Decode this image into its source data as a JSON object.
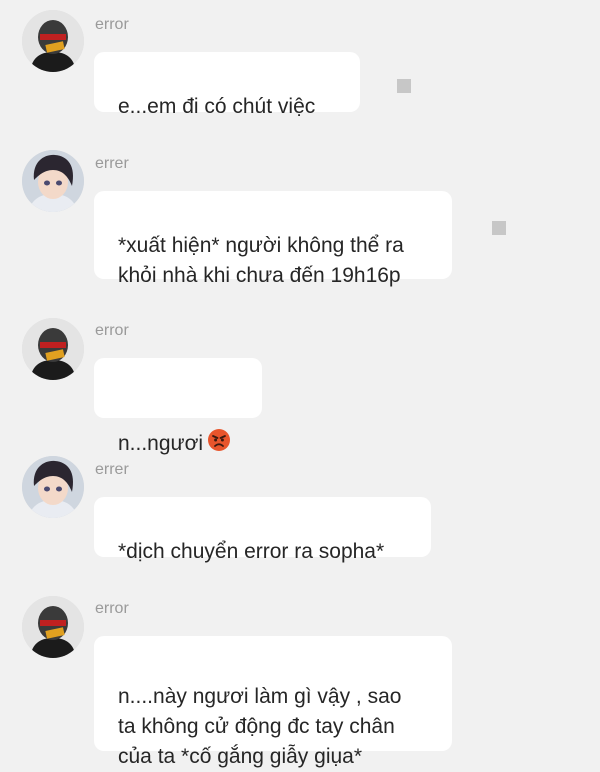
{
  "messages": [
    {
      "sender": "error",
      "avatar": "masked-helmet-avatar",
      "text": "e...em đi có chút việc",
      "emoji": ""
    },
    {
      "sender": "errer",
      "avatar": "anime-boy-avatar",
      "text": "*xuất hiện* người không thể ra khỏi nhà khi chưa đến 19h16p",
      "emoji": ""
    },
    {
      "sender": "error",
      "avatar": "masked-helmet-avatar",
      "text": "n...ngươi",
      "emoji": "😡"
    },
    {
      "sender": "errer",
      "avatar": "anime-boy-avatar",
      "text": "*dịch chuyển error ra sopha*",
      "emoji": ""
    },
    {
      "sender": "error",
      "avatar": "masked-helmet-avatar",
      "text": "n....này ngươi làm gì vậy , sao\nta không cử động đc tay chân\ncủa ta *cố gắng giẫy giụa*",
      "emoji": ""
    }
  ],
  "colors": {
    "background": "#f1f1f1",
    "bubble": "#ffffff",
    "sender_name": "#9a9a9a",
    "text": "#262626"
  }
}
